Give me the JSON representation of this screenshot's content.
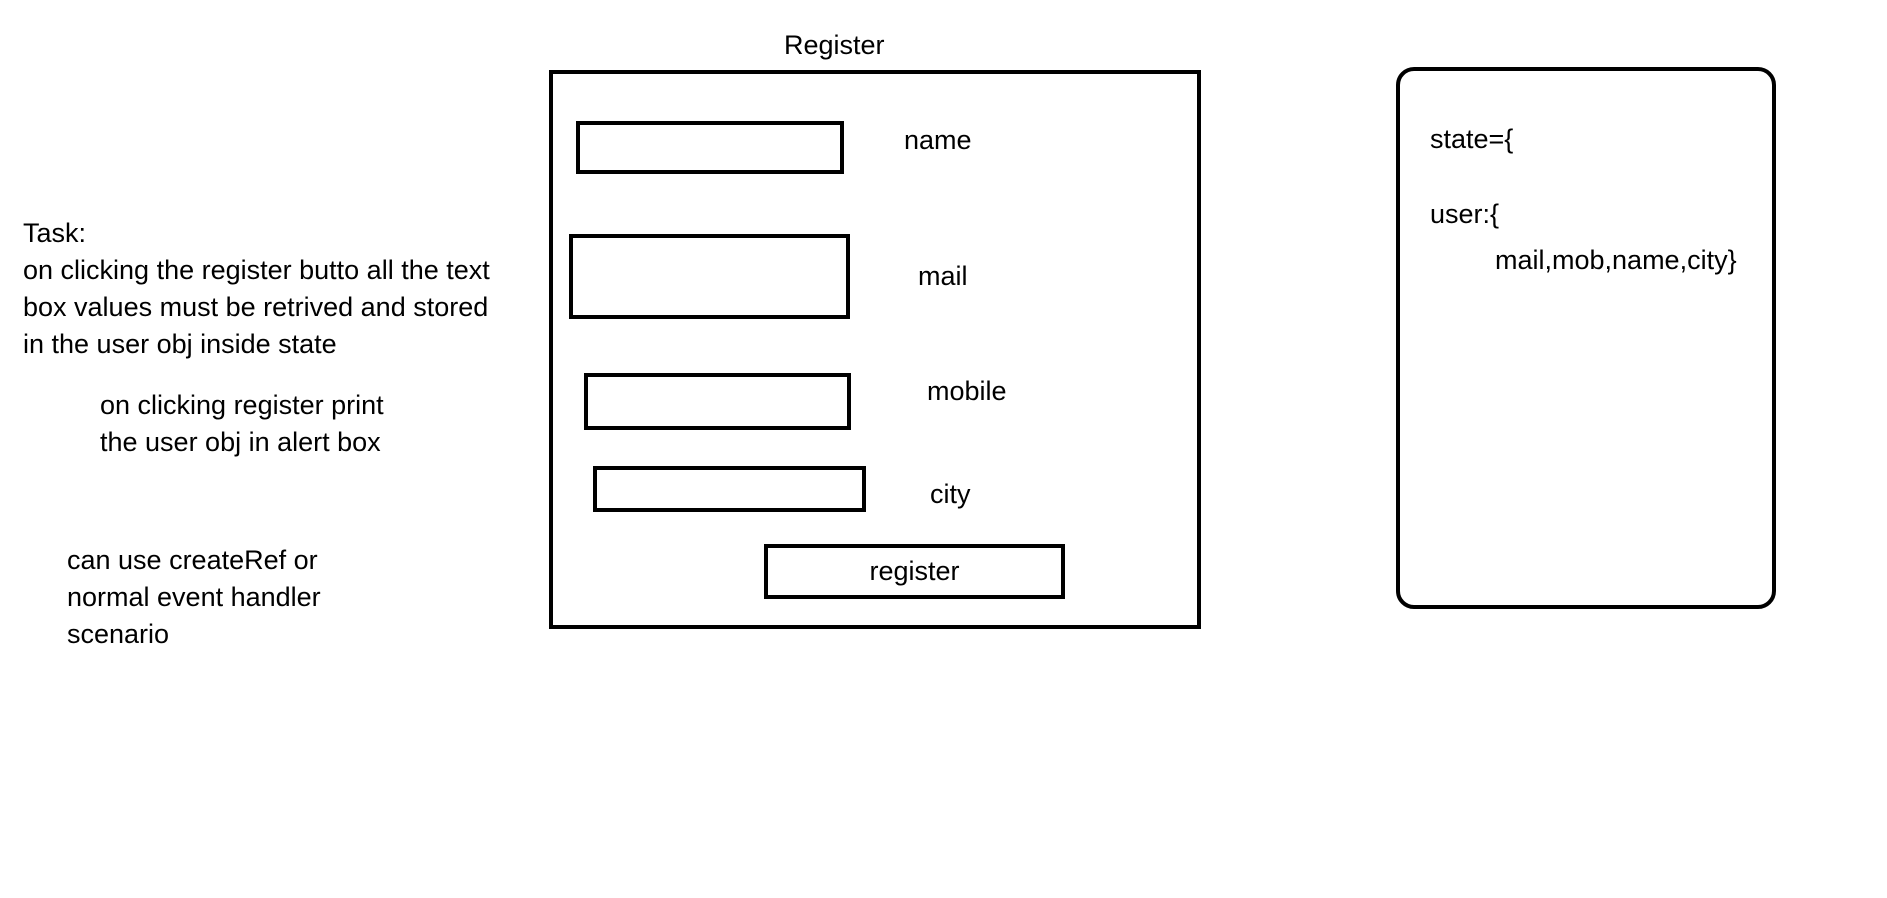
{
  "task": {
    "heading": "Task:",
    "lines": [
      "on clicking the register butto all the text",
      "box values must be  retrived and stored",
      "in the user obj inside state"
    ],
    "alert_lines": [
      "on clicking register print",
      "the user obj in alert box"
    ],
    "hint_lines": [
      "can use createRef or",
      "normal event handler",
      "scenario"
    ]
  },
  "form": {
    "title": "Register",
    "fields": {
      "name": "name",
      "mail": "mail",
      "mobile": "mobile",
      "city": "city"
    },
    "button_label": "register"
  },
  "state": {
    "line1": "state={",
    "line2": "user:{",
    "line3": "mail,mob,name,city}"
  }
}
